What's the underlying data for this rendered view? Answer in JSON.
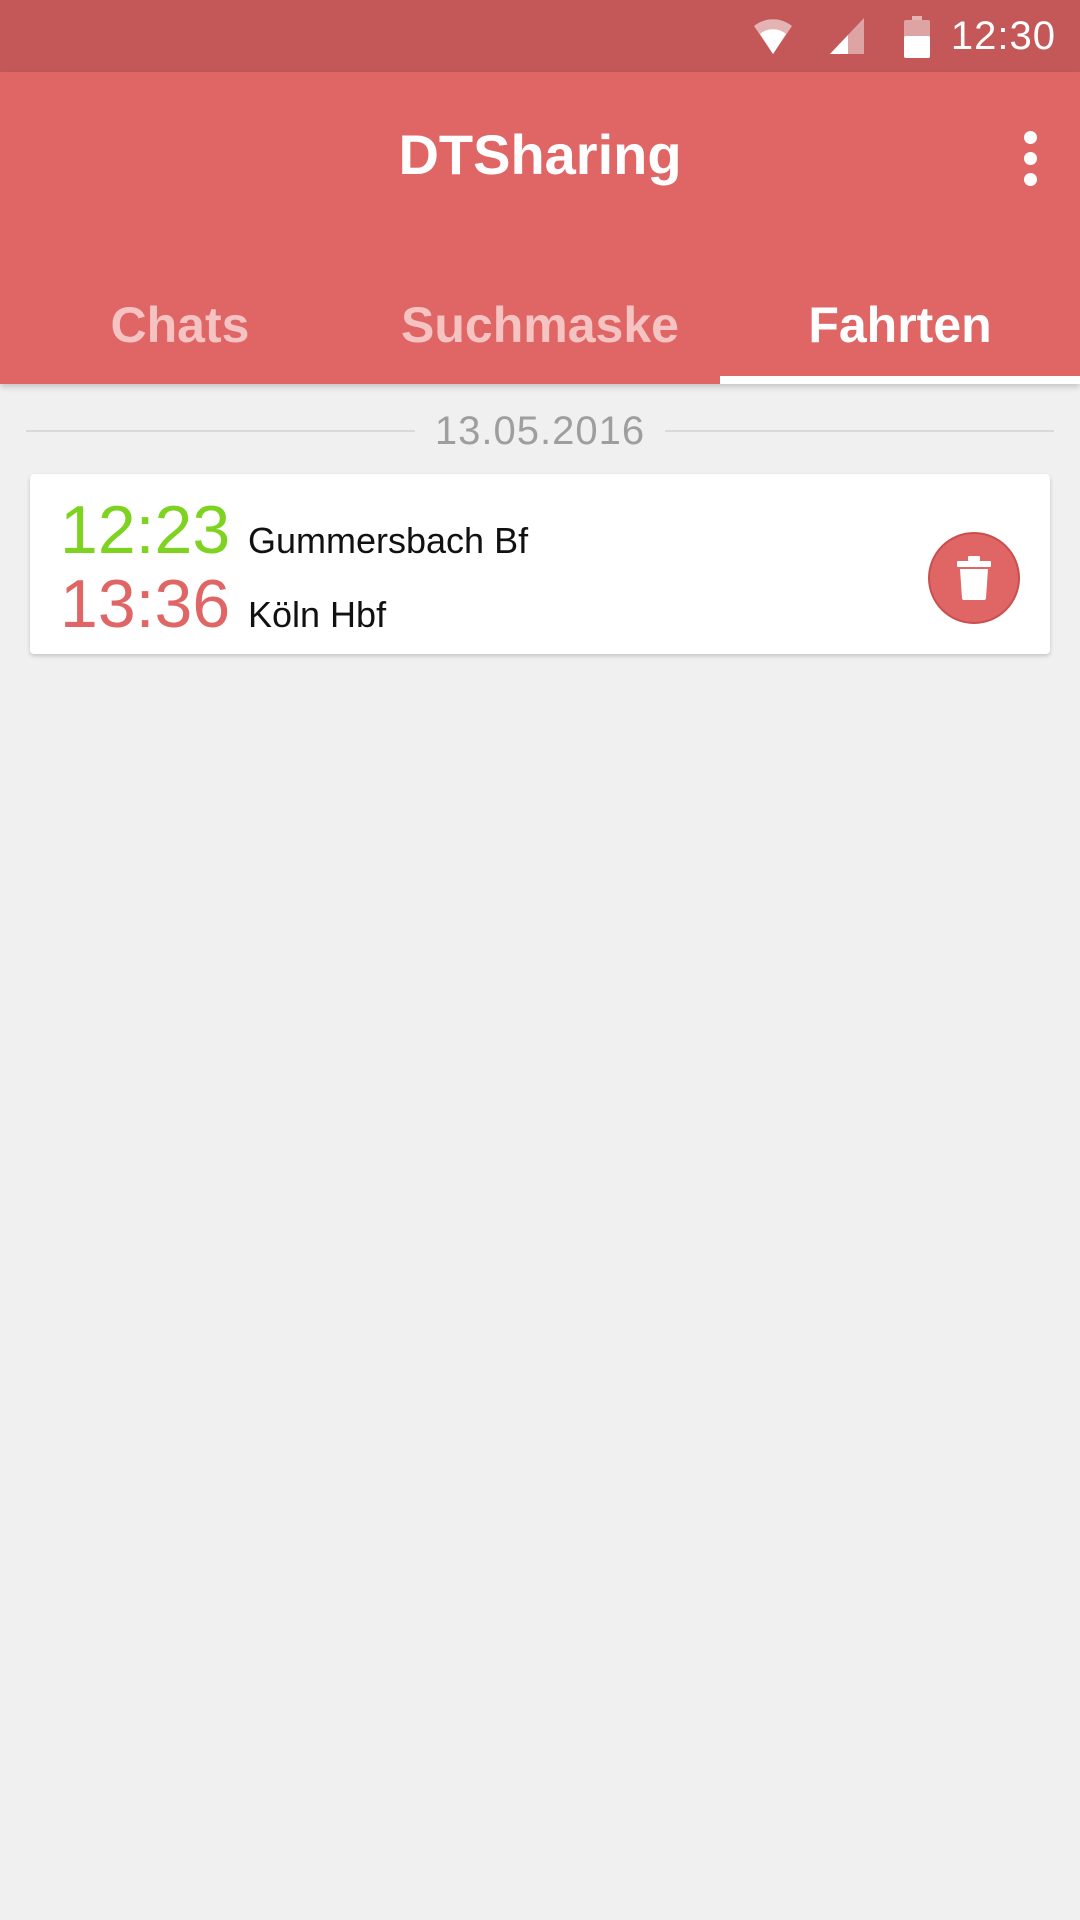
{
  "status_bar": {
    "time": "12:30",
    "icons": [
      "wifi-icon",
      "cell-signal-icon",
      "battery-icon"
    ]
  },
  "app_bar": {
    "title": "DTSharing",
    "menu_icon": "more-vert-icon",
    "color": "#e06666"
  },
  "tabs": [
    {
      "label": "Chats",
      "active": false
    },
    {
      "label": "Suchmaske",
      "active": false
    },
    {
      "label": "Fahrten",
      "active": true
    }
  ],
  "trips": {
    "date": "13.05.2016",
    "items": [
      {
        "departure_time": "12:23",
        "departure_station": "Gummersbach Bf",
        "arrival_time": "13:36",
        "arrival_station": "Köln Hbf",
        "action_icon": "trash-icon"
      }
    ]
  },
  "colors": {
    "departure": "#7ed321",
    "arrival": "#e06666",
    "status_bar": "#c45858",
    "background": "#f0f0f0"
  }
}
